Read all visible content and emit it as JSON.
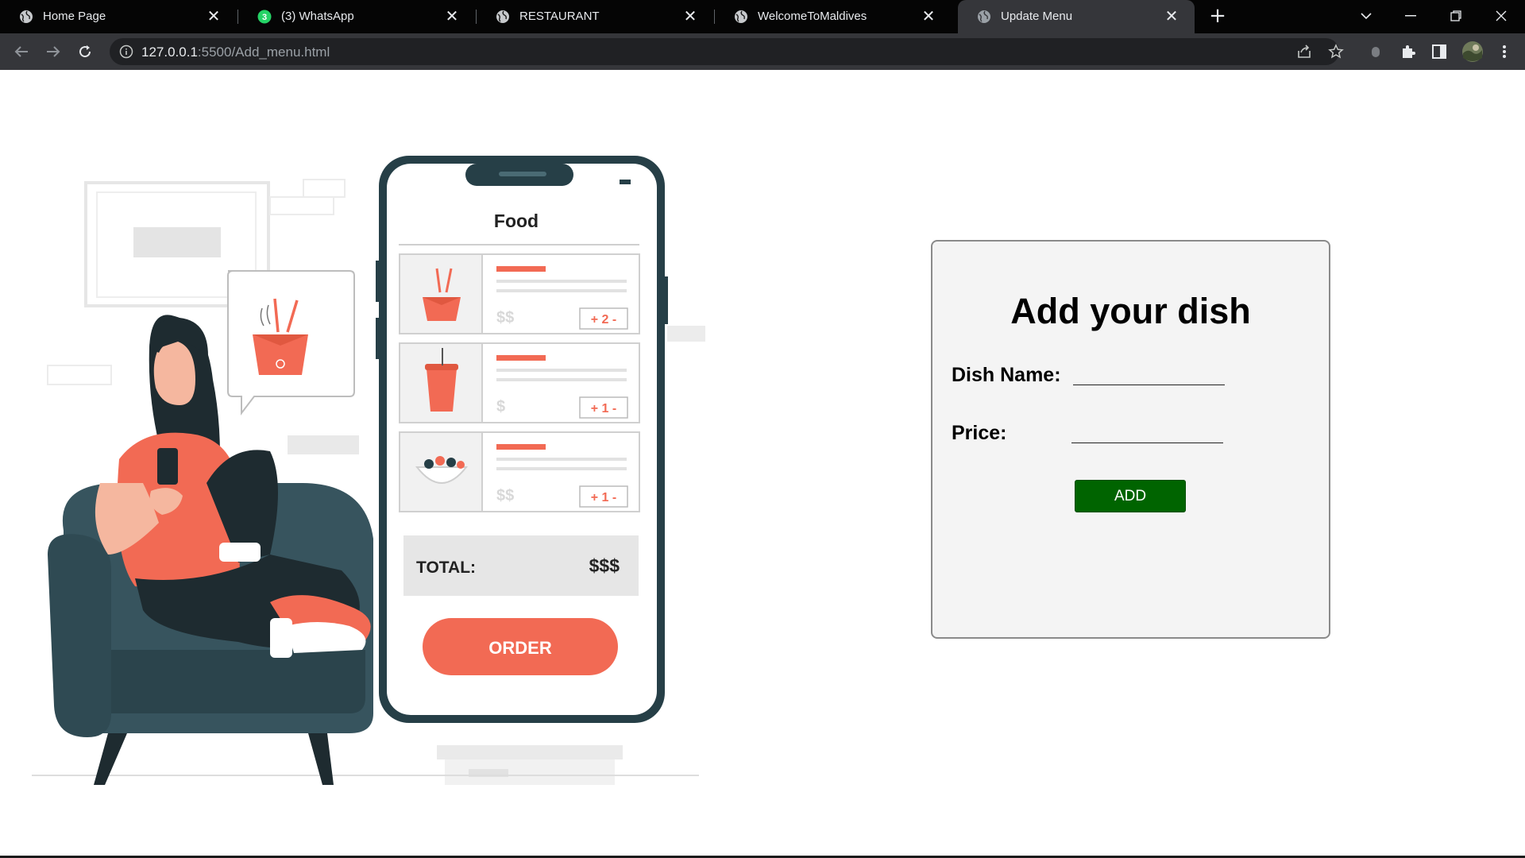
{
  "browser": {
    "tabs": [
      {
        "title": "Home Page",
        "icon": "globe-icon"
      },
      {
        "title": "(3) WhatsApp",
        "icon": "whatsapp-icon",
        "badge": "3"
      },
      {
        "title": "RESTAURANT",
        "icon": "globe-icon"
      },
      {
        "title": "WelcomeToMaldives",
        "icon": "globe-icon"
      },
      {
        "title": "Update Menu",
        "icon": "globe-icon",
        "active": true
      }
    ],
    "url_host": "127.0.0.1",
    "url_rest": ":5500/Add_menu.html"
  },
  "illustration": {
    "app_title": "Food",
    "items": [
      {
        "price": "$$",
        "qty": "+ 2 -"
      },
      {
        "price": "$",
        "qty": "+ 1 -"
      },
      {
        "price": "$$",
        "qty": "+ 1 -"
      }
    ],
    "total_label": "TOTAL:",
    "total_value": "$$$",
    "order_label": "ORDER"
  },
  "form": {
    "heading": "Add your dish",
    "dish_name_label": "Dish Name:",
    "dish_name_value": "",
    "price_label": "Price:",
    "price_value": "",
    "add_label": "ADD"
  },
  "colors": {
    "accent": "#f26a54",
    "button": "#006400",
    "chair": "#37545e",
    "card_bg": "#f4f4f4"
  }
}
